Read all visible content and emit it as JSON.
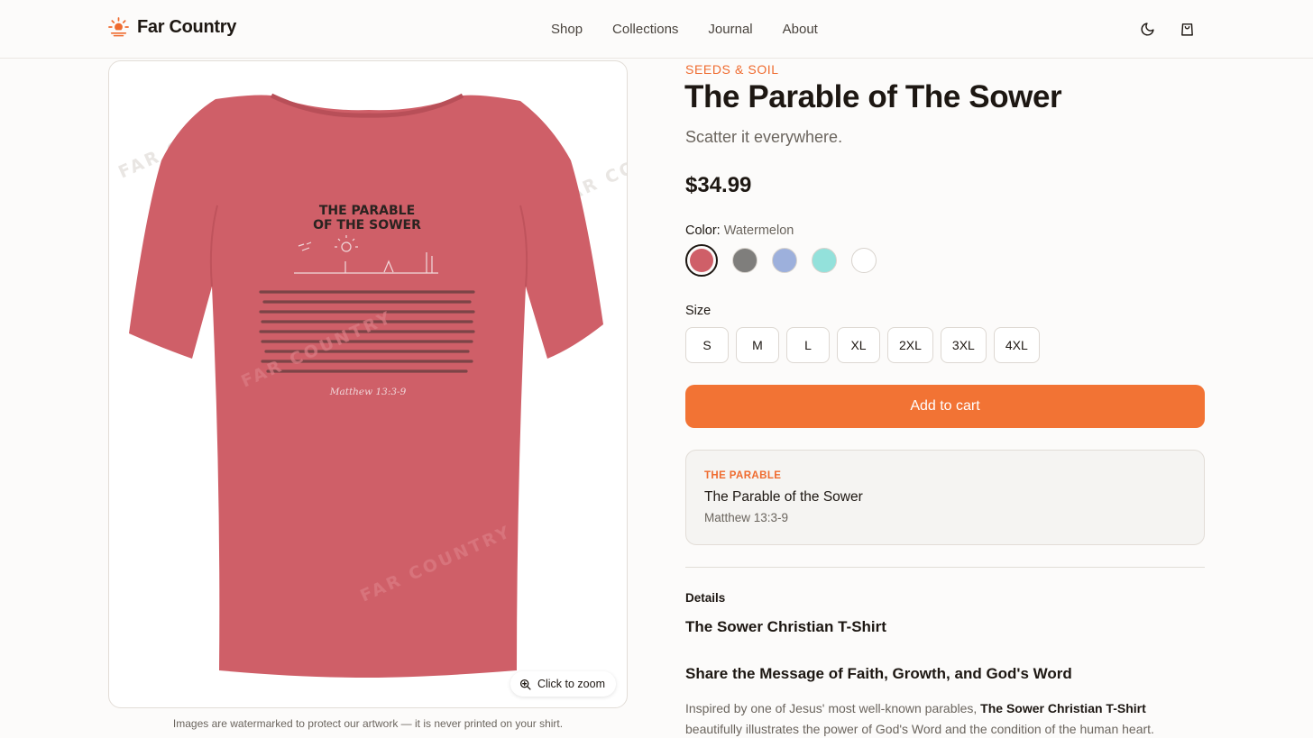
{
  "brand": {
    "name": "Far Country",
    "accent": "#f27334"
  },
  "nav": [
    {
      "label": "Shop"
    },
    {
      "label": "Collections"
    },
    {
      "label": "Journal"
    },
    {
      "label": "About"
    }
  ],
  "header_icons": [
    "moon-icon",
    "shopping-bag-icon"
  ],
  "product_image": {
    "print_title_line1": "THE PARABLE",
    "print_title_line2": "OF THE SOWER",
    "print_reference": "Matthew 13:3-9",
    "watermark": "FAR COUNTRY",
    "shirt_color": "#cf5f68",
    "zoom_label": "Click to zoom",
    "caption": "Images are watermarked to protect our artwork — it is never printed on your shirt."
  },
  "product": {
    "collection": "SEEDS & SOIL",
    "title": "The Parable of The Sower",
    "tagline": "Scatter it everywhere.",
    "price": "$34.99",
    "color_label": "Color:",
    "selected_color": "Watermelon",
    "colors": [
      {
        "name": "Watermelon",
        "hex": "#cf5f68",
        "selected": true
      },
      {
        "name": "Grey",
        "hex": "#7f7e7c",
        "selected": false
      },
      {
        "name": "Blue",
        "hex": "#9db0dc",
        "selected": false
      },
      {
        "name": "Aqua",
        "hex": "#93e1db",
        "selected": false
      },
      {
        "name": "White",
        "hex": "#ffffff",
        "selected": false
      }
    ],
    "size_label": "Size",
    "sizes": [
      "S",
      "M",
      "L",
      "XL",
      "2XL",
      "3XL",
      "4XL"
    ],
    "add_to_cart": "Add to cart"
  },
  "parable_card": {
    "eyebrow": "THE PARABLE",
    "title": "The Parable of the Sower",
    "reference": "Matthew 13:3-9"
  },
  "details": {
    "label": "Details",
    "heading1": "The Sower Christian T-Shirt",
    "heading2": "Share the Message of Faith, Growth, and God's Word",
    "para_lead": "Inspired by one of Jesus' most well-known parables,",
    "para_bold": "The Sower Christian T-Shirt",
    "para_rest": "beautifully illustrates the power of God's Word and the condition of the human heart."
  }
}
